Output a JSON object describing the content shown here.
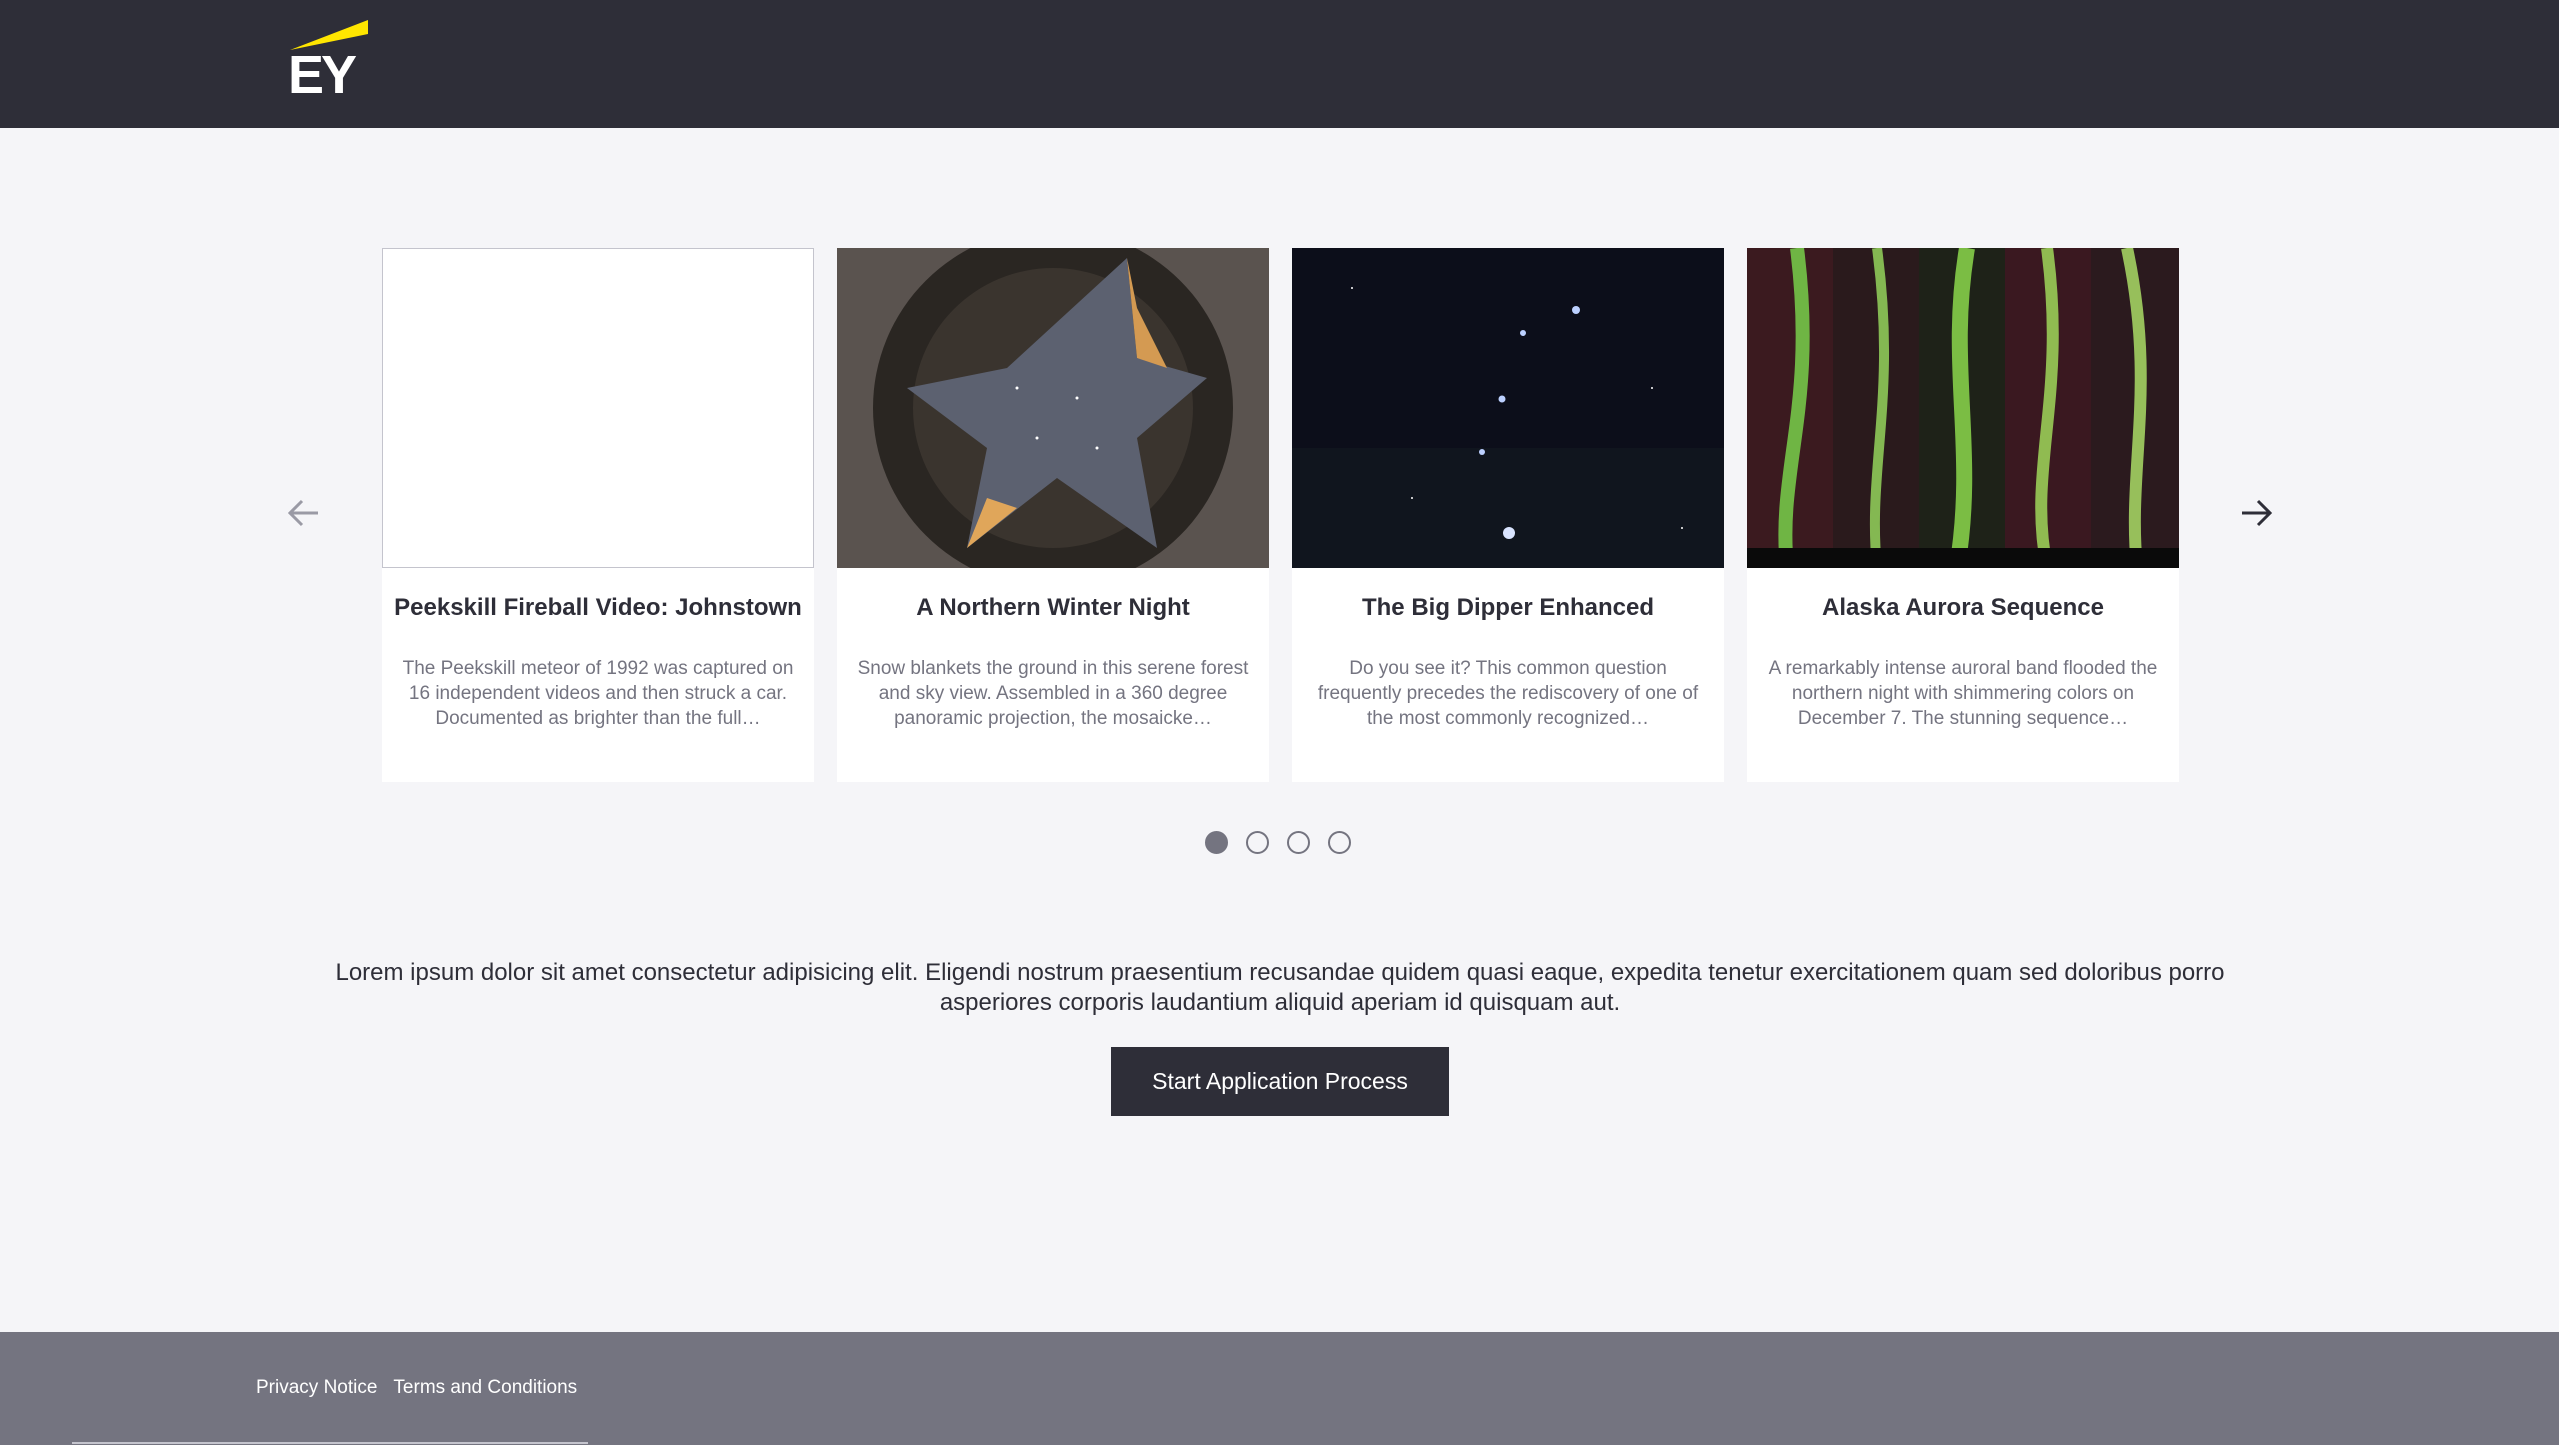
{
  "brand": {
    "logo_text": "EY",
    "accent_color": "#ffe600",
    "dark_color": "#2e2e38",
    "gray_color": "#747480"
  },
  "carousel": {
    "prev_icon": "arrow-left-icon",
    "next_icon": "arrow-right-icon",
    "cards": [
      {
        "title": "Peekskill Fireball Video: Johnstown",
        "description": "The Peekskill meteor of 1992 was captured on 16 independent videos and then struck a car. Documented as brighter than the full…"
      },
      {
        "title": "A Northern Winter Night",
        "description": "Snow blankets the ground in this serene forest and sky view. Assembled in a 360 degree panoramic projection, the mosaicke…"
      },
      {
        "title": "The Big Dipper Enhanced",
        "description": "Do you see it? This common question frequently precedes the rediscovery of one of the most commonly recognized…"
      },
      {
        "title": "Alaska Aurora Sequence",
        "description": "A remarkably intense auroral band flooded the northern night with shimmering colors on December 7. The stunning sequence…"
      }
    ],
    "active_dot": 0,
    "dot_count": 4
  },
  "intro": {
    "text": "Lorem ipsum dolor sit amet consectetur adipisicing elit. Eligendi nostrum praesentium recusandae quidem quasi eaque, expedita tenetur exercitationem quam sed doloribus porro asperiores corporis laudantium aliquid aperiam id quisquam aut."
  },
  "cta": {
    "label": "Start Application Process"
  },
  "footer": {
    "links": [
      {
        "label": "Privacy Notice"
      },
      {
        "label": "Terms and Conditions"
      }
    ]
  }
}
